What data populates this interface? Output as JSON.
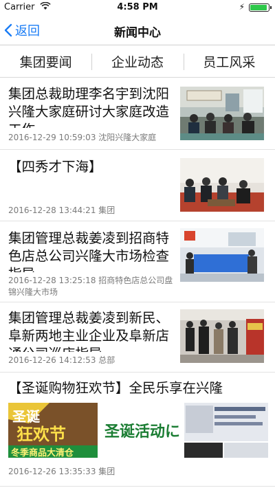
{
  "status": {
    "carrier": "Carrier",
    "time": "4:58 PM"
  },
  "nav": {
    "back_label": "返回",
    "title": "新闻中心"
  },
  "tabs": [
    {
      "label": "集团要闻"
    },
    {
      "label": "企业动态"
    },
    {
      "label": "员工风采"
    }
  ],
  "news": [
    {
      "title": "集团总裁助理李名宇到沈阳兴隆大家庭研讨大家庭改造工作",
      "meta": "2016-12-29 10:59:03 沈阳兴隆大家庭"
    },
    {
      "title": "【四秀才下海】",
      "meta": "2016-12-28 13:44:21 集团"
    },
    {
      "title": "集团管理总裁姜凌到招商特色店总公司兴隆大市场检查指导",
      "meta": "2016-12-28 13:25:18 招商特色店总公司盘锦兴隆大市场"
    },
    {
      "title": "集团管理总裁姜凌到新民、阜新两地主业企业及阜新店通公司巡店指导",
      "meta": "2016-12-26 14:12:53 总部"
    },
    {
      "title": "【圣诞购物狂欢节】全民乐享在兴隆",
      "meta": "2016-12-26 13:35:33 集团",
      "banner": {
        "left_top": "圣诞",
        "left_mid": "狂欢节",
        "left_bottom": "冬季商品大清仓",
        "right_text": "圣诞活动に"
      }
    }
  ]
}
